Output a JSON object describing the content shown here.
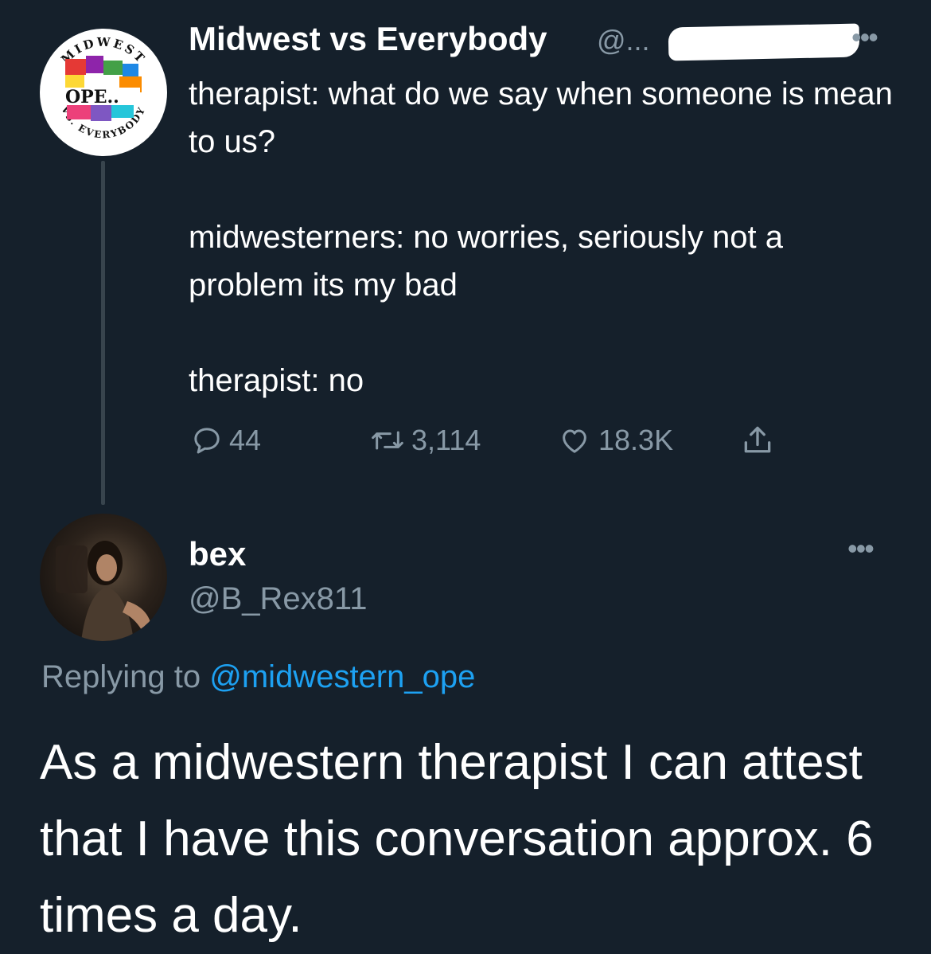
{
  "parent_tweet": {
    "display_name": "Midwest vs Everybody",
    "handle": "@...",
    "more_menu": "•••",
    "avatar_logo": {
      "top_text": "MIDWEST",
      "center_text": "OPE..",
      "bottom_text": "VS. EVERYBODY"
    },
    "lines": [
      "therapist: what do we say when someone is mean to us?",
      "midwesterners: no worries, seriously not a problem its my bad",
      "therapist: no"
    ],
    "stats": {
      "replies": "44",
      "retweets": "3,114",
      "likes": "18.3K"
    }
  },
  "reply_tweet": {
    "display_name": "bex",
    "handle": "@B_Rex811",
    "more_menu": "•••",
    "replying_prefix": "Replying to",
    "replying_mention": "@midwestern_ope",
    "text": "As a midwestern therapist I can attest that I have this conversation approx. 6 times a day."
  },
  "colors": {
    "background": "#15202b",
    "text_primary": "#ffffff",
    "text_secondary": "#8899a6",
    "link": "#1da1f2",
    "thread_line": "#38444d"
  },
  "icons": [
    "reply-icon",
    "retweet-icon",
    "like-icon",
    "share-icon",
    "more-icon"
  ]
}
